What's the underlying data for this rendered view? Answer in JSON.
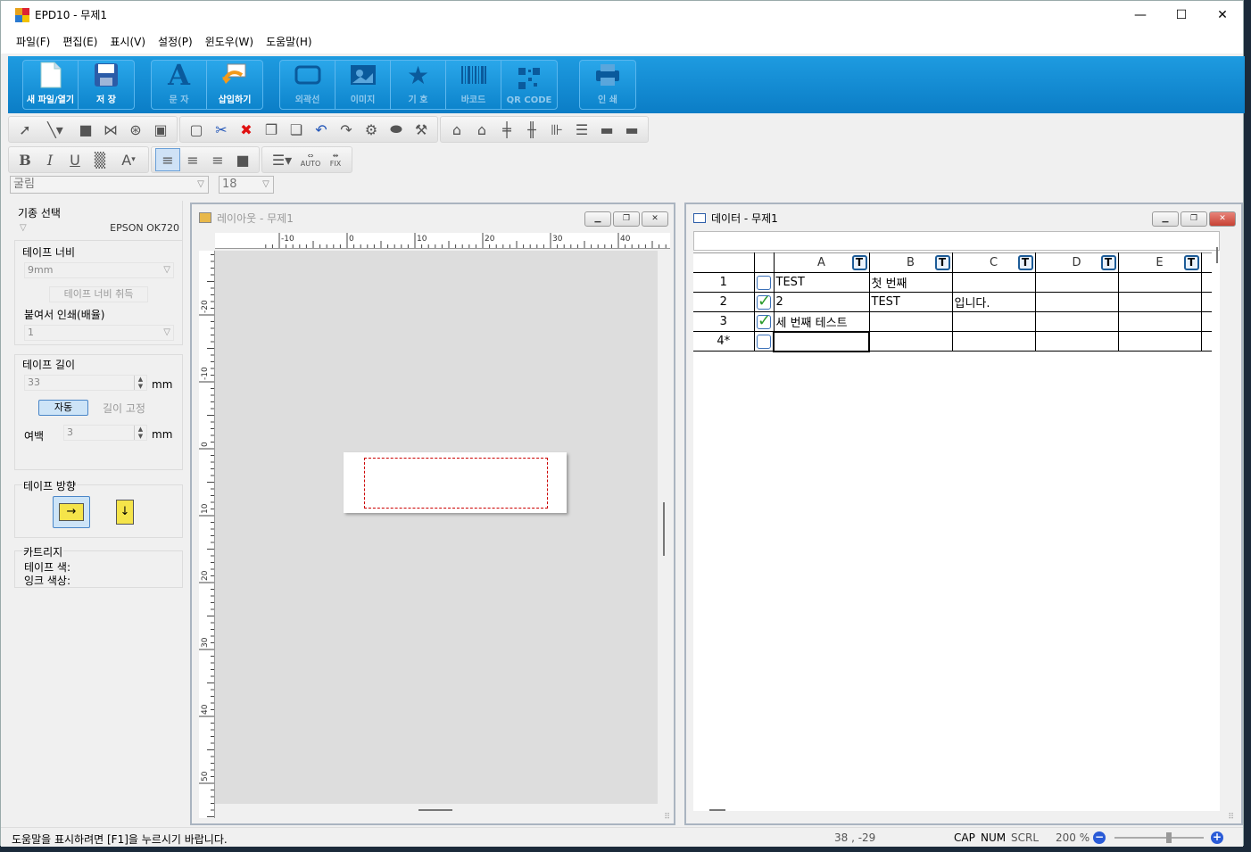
{
  "window": {
    "title": "EPD10 - 무제1"
  },
  "menu": [
    "파일(F)",
    "편집(E)",
    "표시(V)",
    "설정(P)",
    "윈도우(W)",
    "도움말(H)"
  ],
  "ribbon": {
    "new_open": "새 파일/열기",
    "save": "저 장",
    "text": "문 자",
    "insert": "삽입하기",
    "frame": "외곽선",
    "image": "이미지",
    "symbol": "기 호",
    "barcode": "바코드",
    "qrcode": "QR CODE",
    "print": "인 쇄"
  },
  "format_toolbar": {
    "bold": "B",
    "italic": "I",
    "underline": "U",
    "font_color": "A",
    "auto": "AUTO",
    "fix": "FIX"
  },
  "font": {
    "family": "굴림",
    "size": "18"
  },
  "left_panel": {
    "model_label": "기종 선택",
    "model_value": "EPSON OK720",
    "tape_width_label": "테이프 너비",
    "tape_width_value": "9mm",
    "get_width_button": "테이프 너비 취득",
    "multiple_label": "붙여서 인쇄(배율)",
    "multiple_value": "1",
    "tape_length_label": "테이프 길이",
    "tape_length_value": "33",
    "unit_mm": "mm",
    "auto_button": "자동",
    "fixed_length_button": "길이 고정",
    "margin_label": "여백",
    "margin_value": "3",
    "direction_label": "테이프 방향",
    "cartridge_label": "카트리지",
    "tape_color_label": "테이프 색:",
    "ink_color_label": "잉크 색상:"
  },
  "layout_window": {
    "title": "레이아웃  - 무제1",
    "ruler_top": [
      "-10",
      "0",
      "10",
      "20",
      "30",
      "40"
    ],
    "ruler_left": [
      "-20",
      "-10",
      "0",
      "10",
      "20",
      "30",
      "40",
      "50"
    ]
  },
  "data_window": {
    "title": "데이터  - 무제1",
    "columns": [
      "A",
      "B",
      "C",
      "D",
      "E"
    ],
    "type_badge": "T",
    "rows": [
      {
        "num": "1",
        "checked": false,
        "cells": [
          "TEST",
          "첫 번째",
          "",
          "",
          ""
        ]
      },
      {
        "num": "2",
        "checked": true,
        "cells": [
          "2",
          "TEST",
          "입니다.",
          "",
          ""
        ]
      },
      {
        "num": "3",
        "checked": true,
        "cells": [
          "세 번째 테스트",
          "",
          "",
          "",
          ""
        ]
      },
      {
        "num": "4*",
        "checked": false,
        "cells": [
          "",
          "",
          "",
          "",
          ""
        ]
      }
    ]
  },
  "status": {
    "help": "도움말을 표시하려면 [F1]을 누르시기 바랍니다.",
    "coords": "38 , -29",
    "cap": "CAP",
    "num": "NUM",
    "scrl": "SCRL",
    "zoom": "200 %"
  },
  "colors": {
    "ribbon_blue": "#0b7dc6",
    "check_green": "#2a9a2a",
    "label_border": "#cc0000"
  }
}
